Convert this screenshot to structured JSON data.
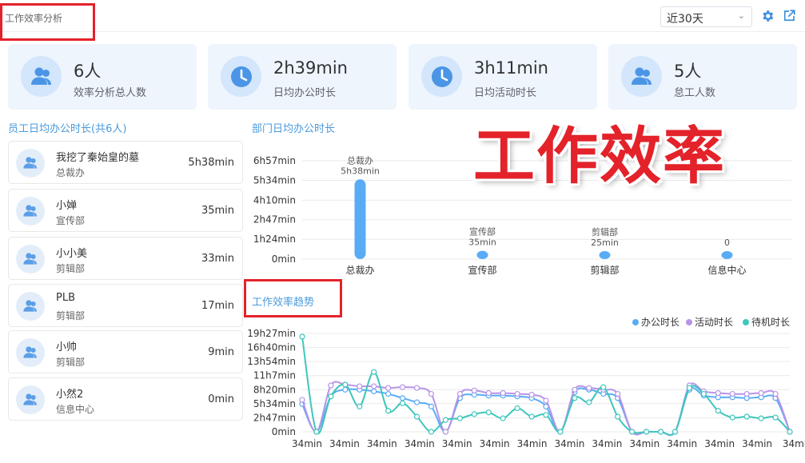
{
  "header": {
    "title": "工作效率分析",
    "period": "近30天"
  },
  "cards": [
    {
      "value": "6人",
      "label": "效率分析总人数",
      "icon": "users-icon"
    },
    {
      "value": "2h39min",
      "label": "日均办公时长",
      "icon": "clock-icon"
    },
    {
      "value": "3h11min",
      "label": "日均活动时长",
      "icon": "clock-icon"
    },
    {
      "value": "5人",
      "label": "怠工人数",
      "icon": "users-icon"
    }
  ],
  "employee_section": {
    "title": "员工日均办公时长(共6人)",
    "items": [
      {
        "name": "我挖了秦始皇的墓",
        "dept": "总裁办",
        "duration": "5h38min"
      },
      {
        "name": "小婵",
        "dept": "宣传部",
        "duration": "35min"
      },
      {
        "name": "小小美",
        "dept": "剪辑部",
        "duration": "33min"
      },
      {
        "name": "PLB",
        "dept": "剪辑部",
        "duration": "17min"
      },
      {
        "name": "小帅",
        "dept": "剪辑部",
        "duration": "9min"
      },
      {
        "name": "小然2",
        "dept": "信息中心",
        "duration": "0min"
      }
    ]
  },
  "overlay_text": "工作效率",
  "colors": {
    "accent": "#4a9bdc",
    "bar": "#5aabf6",
    "office": "#5aabf6",
    "activity": "#b794e6",
    "standby": "#3ec6bd",
    "highlight": "#e3222a"
  },
  "chart_data": [
    {
      "type": "bar",
      "title": "部门日均办公时长",
      "categories": [
        "总裁办",
        "宣传部",
        "剪辑部",
        "信息中心"
      ],
      "values": [
        338,
        35,
        25,
        0
      ],
      "value_labels": [
        "5h38min",
        "35min",
        "25min",
        "0"
      ],
      "ylim": [
        0,
        417
      ],
      "yticks": [
        0,
        84,
        167,
        250,
        334,
        417
      ],
      "ytick_labels": [
        "0min",
        "1h24min",
        "2h47min",
        "4h10min",
        "5h34min",
        "6h57min"
      ],
      "grid": true
    },
    {
      "type": "line",
      "title": "工作效率趋势",
      "legend_position": "top-right",
      "x_tick_labels": [
        "34min",
        "34min",
        "34min",
        "34min",
        "34min",
        "34min",
        "34min",
        "34min",
        "34min",
        "34min",
        "34min",
        "34min",
        "34min",
        "34mi"
      ],
      "ylim": [
        0,
        1167
      ],
      "yticks": [
        0,
        167,
        334,
        500,
        667,
        834,
        1000,
        1167
      ],
      "ytick_labels": [
        "0min",
        "2h47min",
        "5h34min",
        "8h20min",
        "11h7min",
        "13h54min",
        "16h40min",
        "19h27min"
      ],
      "grid": true,
      "series": [
        {
          "name": "办公时长",
          "values": [
            330,
            0,
            420,
            500,
            500,
            480,
            450,
            400,
            350,
            300,
            0,
            400,
            440,
            430,
            430,
            420,
            400,
            300,
            0,
            470,
            500,
            450,
            400,
            0,
            0,
            0,
            0,
            500,
            430,
            410,
            410,
            400,
            410,
            400,
            0
          ]
        },
        {
          "name": "活动时长",
          "values": [
            380,
            0,
            550,
            560,
            540,
            540,
            520,
            530,
            520,
            450,
            0,
            450,
            490,
            460,
            460,
            450,
            440,
            370,
            0,
            500,
            520,
            500,
            450,
            0,
            0,
            0,
            0,
            550,
            480,
            460,
            450,
            450,
            460,
            450,
            0
          ]
        },
        {
          "name": "待机时长",
          "values": [
            1130,
            0,
            420,
            560,
            300,
            710,
            250,
            340,
            180,
            0,
            140,
            160,
            210,
            230,
            160,
            280,
            180,
            200,
            0,
            400,
            350,
            530,
            180,
            0,
            0,
            0,
            0,
            520,
            450,
            250,
            170,
            180,
            160,
            170,
            0
          ]
        }
      ]
    }
  ]
}
